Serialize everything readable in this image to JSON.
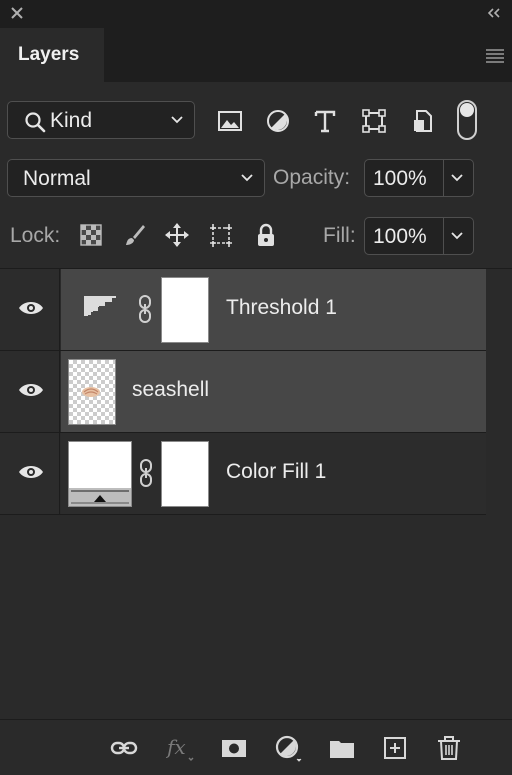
{
  "panel": {
    "tab_label": "Layers"
  },
  "filter": {
    "kind_label": "Kind",
    "icons": [
      "image-filter-icon",
      "adjustment-filter-icon",
      "type-filter-icon",
      "shape-filter-icon",
      "smart-object-filter-icon"
    ],
    "toggle": "filter-toggle"
  },
  "blend": {
    "mode": "Normal",
    "opacity_label": "Opacity:",
    "opacity_value": "100%"
  },
  "lock": {
    "label": "Lock:",
    "icons": [
      "lock-transparent-pixels-icon",
      "lock-image-pixels-icon",
      "lock-position-icon",
      "lock-artboard-icon",
      "lock-all-icon"
    ],
    "fill_label": "Fill:",
    "fill_value": "100%"
  },
  "layers": [
    {
      "name": "Threshold 1",
      "type": "adjustment",
      "visible": true,
      "selected": true
    },
    {
      "name": "seashell",
      "type": "pixel",
      "visible": true,
      "selected": true
    },
    {
      "name": "Color Fill 1",
      "type": "fill",
      "visible": true,
      "selected": false
    }
  ],
  "footer": {
    "icons": [
      "link-layers-icon",
      "fx-icon",
      "add-mask-icon",
      "new-adjustment-icon",
      "new-group-icon",
      "new-layer-icon",
      "delete-icon"
    ]
  },
  "colors": {
    "panel_bg": "#2a2a2a",
    "selected_row": "#474747",
    "unselected_row": "#2c2c2c",
    "text": "#ececec"
  }
}
